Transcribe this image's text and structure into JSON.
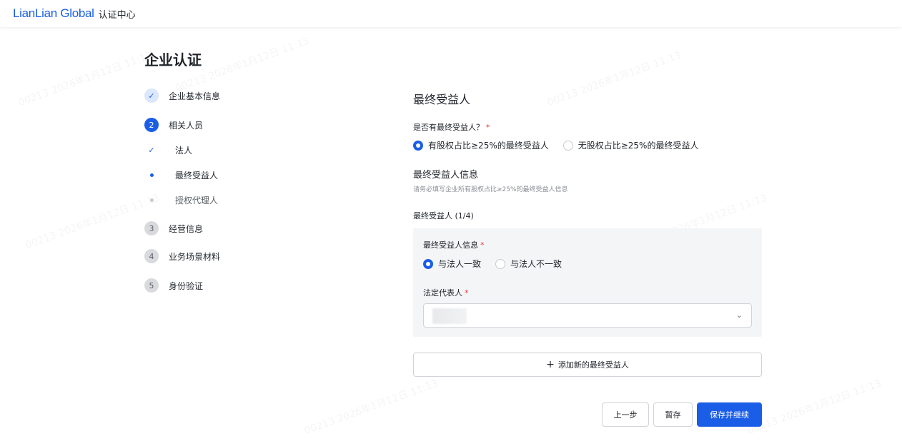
{
  "header": {
    "logo": "LianLian Global",
    "title": "认证中心"
  },
  "page": {
    "title": "企业认证"
  },
  "steps": [
    {
      "marker": "✓",
      "label": "企业基本信息"
    },
    {
      "marker": "2",
      "label": "相关人员"
    },
    {
      "marker": "3",
      "label": "经营信息"
    },
    {
      "marker": "4",
      "label": "业务场景材料"
    },
    {
      "marker": "5",
      "label": "身份验证"
    }
  ],
  "substeps": [
    {
      "marker": "✓",
      "label": "法人"
    },
    {
      "label": "最终受益人"
    },
    {
      "label": "授权代理人"
    }
  ],
  "form": {
    "section_title": "最终受益人",
    "has_ubo_question": "是否有最终受益人？",
    "required_mark": "*",
    "has_ubo_options": [
      "有股权占比≥25%的最终受益人",
      "无股权占比≥25%的最终受益人"
    ],
    "info_title": "最终受益人信息",
    "info_hint": "请务必填写企业所有股权占比≥25%的最终受益人信息",
    "ubo_counter": "最终受益人 (1/4)",
    "card": {
      "info_label": "最终受益人信息",
      "info_options": [
        "与法人一致",
        "与法人不一致"
      ],
      "legal_rep_label": "法定代表人",
      "chevron": "⌄"
    },
    "add_button": {
      "icon": "+",
      "label": "添加新的最终受益人"
    }
  },
  "actions": {
    "prev": "上一步",
    "draft": "暂存",
    "save": "保存并继续"
  },
  "watermark": "00213 2026年1月12日 11:13",
  "colors": {
    "primary": "#1a5ee8",
    "required": "#e5363a"
  }
}
